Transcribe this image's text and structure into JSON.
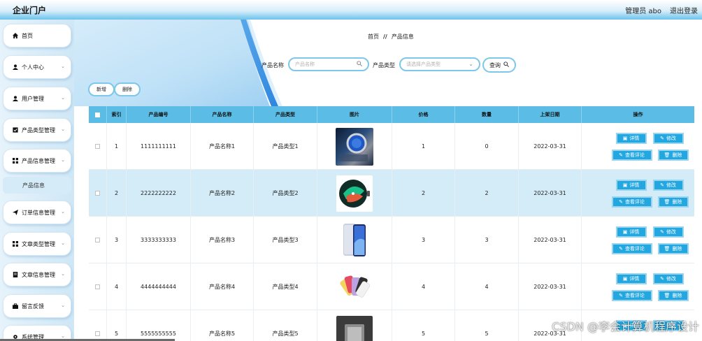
{
  "header": {
    "brand": "企业门户",
    "admin": "管理员 abo",
    "logout": "退出登录"
  },
  "sidebar": {
    "items": [
      {
        "label": "首页",
        "icon": "home-icon",
        "chevron": false
      },
      {
        "label": "个人中心",
        "icon": "user-icon",
        "chevron": true
      },
      {
        "label": "用户管理",
        "icon": "user-icon",
        "chevron": true
      },
      {
        "label": "产品类型管理",
        "icon": "checkbox-icon",
        "chevron": true
      },
      {
        "label": "产品信息管理",
        "icon": "grid-icon",
        "chevron": true
      },
      {
        "label": "订单信息管理",
        "icon": "send-icon",
        "chevron": true
      },
      {
        "label": "文章类型管理",
        "icon": "grid-icon",
        "chevron": true
      },
      {
        "label": "文章信息管理",
        "icon": "doc-icon",
        "chevron": true
      },
      {
        "label": "留言反馈",
        "icon": "briefcase-icon",
        "chevron": true
      },
      {
        "label": "系统管理",
        "icon": "gear-icon",
        "chevron": true
      }
    ],
    "sub_item": "产品信息"
  },
  "breadcrumb": {
    "home": "首页",
    "separator": "//",
    "current": "产品信息"
  },
  "search": {
    "name_label": "产品名称",
    "name_placeholder": "产品名称",
    "type_label": "产品类型",
    "type_placeholder": "请选择产品类型",
    "query": "查询"
  },
  "toolbar": {
    "add": "新增",
    "delete": "删除"
  },
  "table": {
    "headers": [
      "索引",
      "产品编号",
      "产品名称",
      "产品类型",
      "图片",
      "价格",
      "数量",
      "上架日期",
      "操作"
    ],
    "rows": [
      {
        "index": "1",
        "code": "1111111111",
        "name": "产品名称1",
        "type": "产品类型1",
        "price": "1",
        "qty": "0",
        "date": "2022-03-31",
        "image": "watch-image"
      },
      {
        "index": "2",
        "code": "2222222222",
        "name": "产品名称2",
        "type": "产品类型2",
        "price": "2",
        "qty": "2",
        "date": "2022-03-31",
        "image": "watchface-image"
      },
      {
        "index": "3",
        "code": "3333333333",
        "name": "产品名称3",
        "type": "产品类型3",
        "price": "3",
        "qty": "3",
        "date": "2022-03-31",
        "image": "phone-image"
      },
      {
        "index": "4",
        "code": "4444444444",
        "name": "产品名称4",
        "type": "产品类型4",
        "price": "4",
        "qty": "4",
        "date": "2022-03-31",
        "image": "iphone-colors-image"
      },
      {
        "index": "5",
        "code": "5555555555",
        "name": "产品名称5",
        "type": "产品类型5",
        "price": "5",
        "qty": "5",
        "date": "2022-03-31",
        "image": "device-image"
      }
    ],
    "actions": {
      "detail": "详情",
      "edit": "修改",
      "comments": "查看评论",
      "delete": "删除"
    }
  },
  "watermark": "CSDN @李会计算机程序设计",
  "colors": {
    "accent": "#23a7e0",
    "header_row": "#5bbde6",
    "highlight_row": "#d3ecf8"
  }
}
